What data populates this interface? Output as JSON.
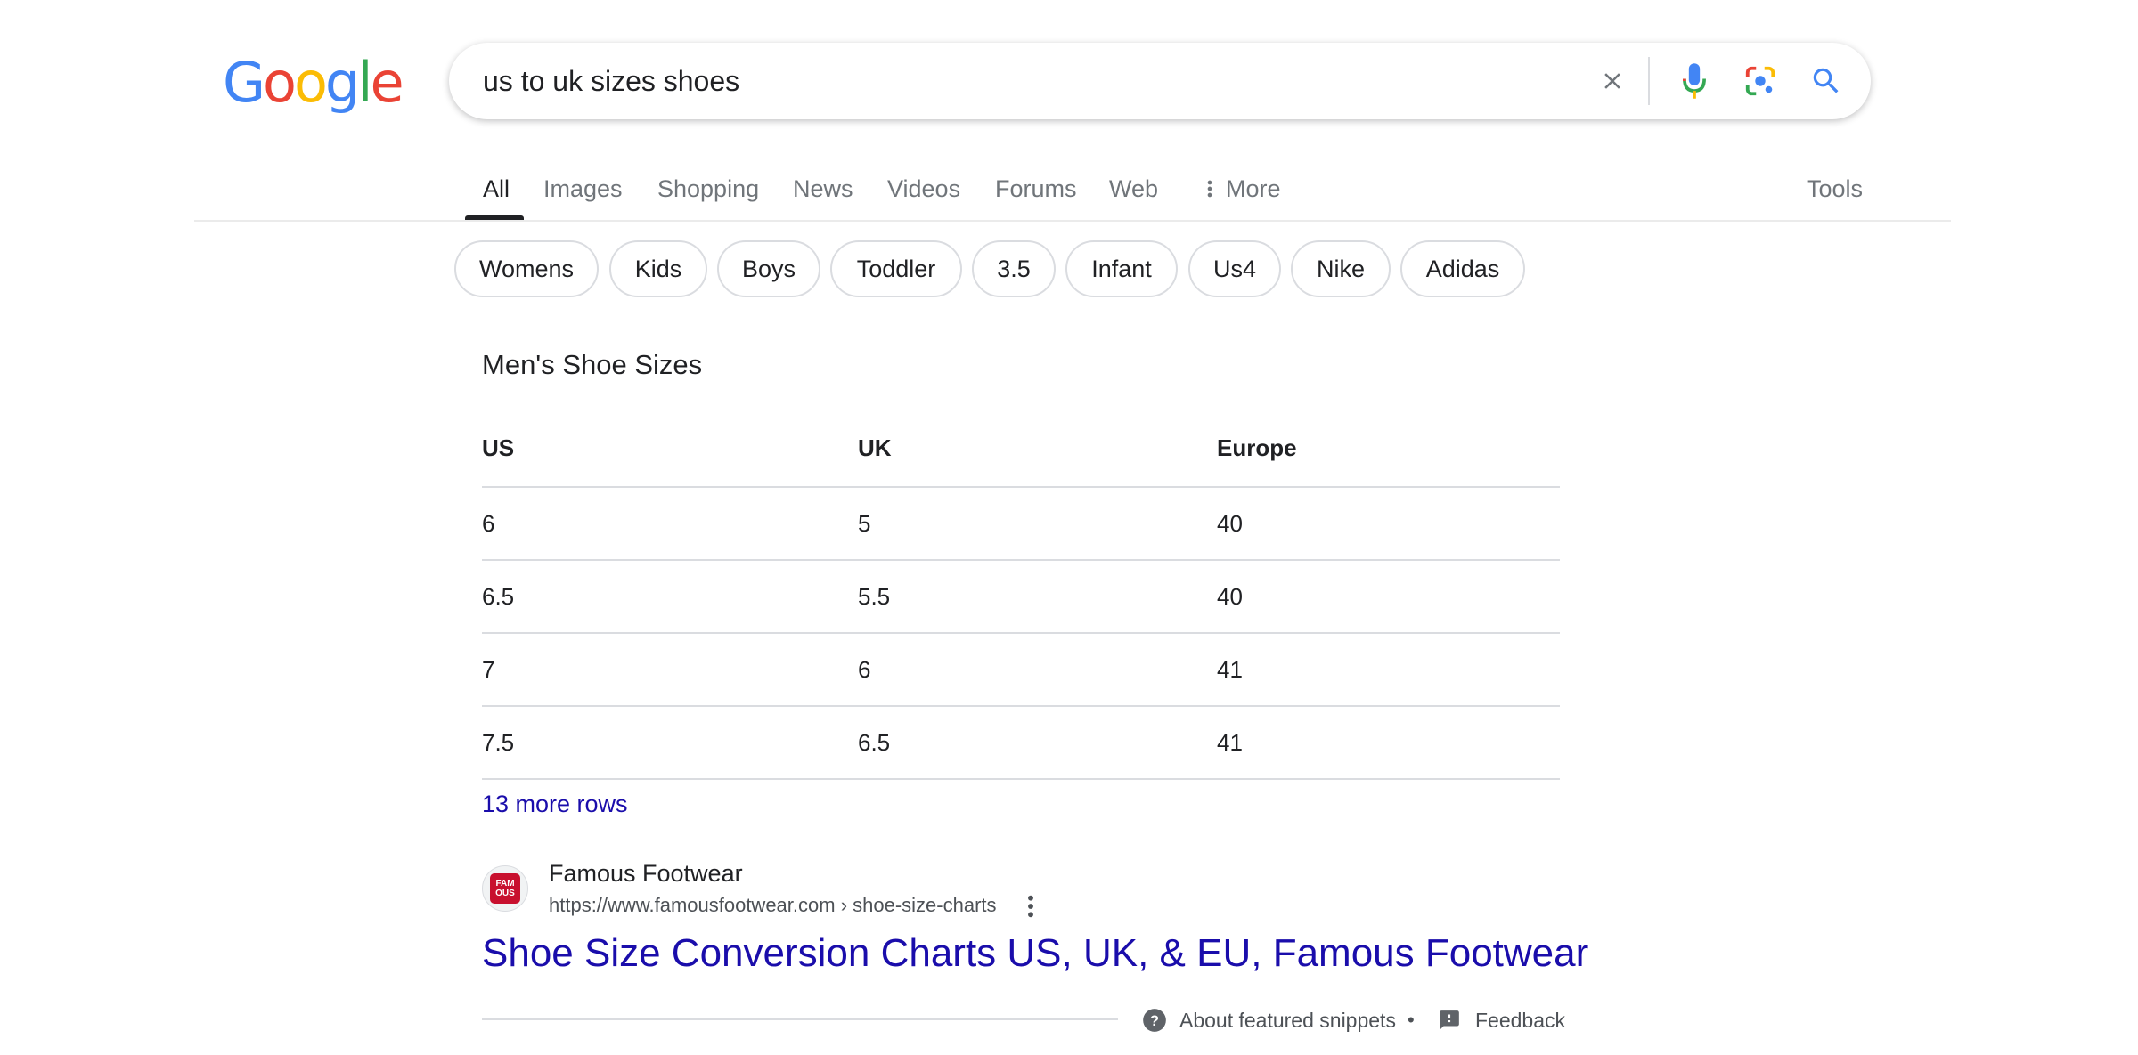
{
  "logo": {
    "letters": [
      "G",
      "o",
      "o",
      "g",
      "l",
      "e"
    ],
    "colors": [
      "#4285F4",
      "#EA4335",
      "#FBBC05",
      "#4285F4",
      "#34A853",
      "#EA4335"
    ]
  },
  "search": {
    "query": "us to uk sizes shoes",
    "icons": [
      "clear-icon",
      "microphone-icon",
      "lens-icon",
      "search-icon"
    ]
  },
  "tabs": {
    "items": [
      "All",
      "Images",
      "Shopping",
      "News",
      "Videos",
      "Forums",
      "Web",
      "More"
    ],
    "active": "All",
    "tools": "Tools"
  },
  "chips": [
    "Womens",
    "Kids",
    "Boys",
    "Toddler",
    "3.5",
    "Infant",
    "Us4",
    "Nike",
    "Adidas"
  ],
  "snippet": {
    "title": "Men's Shoe Sizes",
    "columns": [
      "US",
      "UK",
      "Europe"
    ],
    "rows": [
      [
        "6",
        "5",
        "40"
      ],
      [
        "6.5",
        "5.5",
        "40"
      ],
      [
        "7",
        "6",
        "41"
      ],
      [
        "7.5",
        "6.5",
        "41"
      ]
    ],
    "more_rows": "13 more rows"
  },
  "result": {
    "favicon_text": "FAM OUS",
    "site_name": "Famous Footwear",
    "url": "https://www.famousfootwear.com › shoe-size-charts",
    "title": "Shoe Size Conversion Charts US, UK, & EU, Famous Footwear"
  },
  "footer": {
    "about": "About featured snippets",
    "separator": "•",
    "feedback": "Feedback"
  },
  "colors": {
    "link": "#1a0dab",
    "text": "#202124",
    "muted": "#70757a",
    "border": "#dadce0"
  }
}
